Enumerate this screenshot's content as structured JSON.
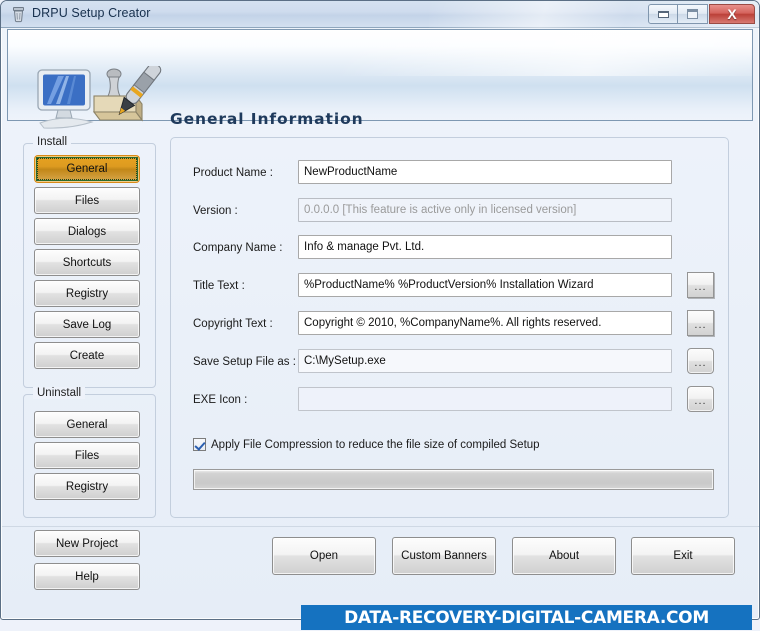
{
  "window": {
    "title": "DRPU Setup Creator",
    "icon": "app-icon",
    "controls": {
      "minimize": "minimize-icon",
      "maximize": "maximize-icon",
      "close": "X"
    }
  },
  "banner": {
    "heading": "General Information",
    "art": "computer-stamp-pen-illustration"
  },
  "sidebar": {
    "install": {
      "legend": "Install",
      "items": [
        {
          "label": "General",
          "selected": true
        },
        {
          "label": "Files",
          "selected": false
        },
        {
          "label": "Dialogs",
          "selected": false
        },
        {
          "label": "Shortcuts",
          "selected": false
        },
        {
          "label": "Registry",
          "selected": false
        },
        {
          "label": "Save Log",
          "selected": false
        },
        {
          "label": "Create",
          "selected": false
        }
      ]
    },
    "uninstall": {
      "legend": "Uninstall",
      "items": [
        {
          "label": "General"
        },
        {
          "label": "Files"
        },
        {
          "label": "Registry"
        }
      ]
    },
    "extra": [
      {
        "label": "New Project"
      },
      {
        "label": "Help"
      }
    ]
  },
  "form": {
    "fields": [
      {
        "label": "Product Name :",
        "value": "NewProductName",
        "state": "normal",
        "browse": false
      },
      {
        "label": "Version :",
        "value": "0.0.0.0 [This feature is active only in licensed version]",
        "state": "disabled",
        "browse": false
      },
      {
        "label": "Company Name :",
        "value": "Info & manage Pvt. Ltd.",
        "state": "normal",
        "browse": false
      },
      {
        "label": "Title Text :",
        "value": "%ProductName% %ProductVersion% Installation Wizard",
        "state": "normal",
        "browse": true,
        "browse_style": "flat"
      },
      {
        "label": "Copyright Text :",
        "value": "Copyright © 2010, %CompanyName%. All rights reserved.",
        "state": "normal",
        "browse": true,
        "browse_style": "flat"
      },
      {
        "label": "Save Setup File as :",
        "value": "C:\\MySetup.exe",
        "state": "normal",
        "browse": true,
        "browse_style": "round"
      },
      {
        "label": "EXE Icon :",
        "value": "",
        "state": "empty",
        "browse": true,
        "browse_style": "round"
      }
    ],
    "browse_label": "...",
    "checkbox": {
      "label": "Apply File Compression to reduce the file size of compiled Setup",
      "checked": true
    },
    "progress": {
      "value": 0
    }
  },
  "actions": [
    {
      "label": "Open"
    },
    {
      "label": "Custom Banners"
    },
    {
      "label": "About"
    },
    {
      "label": "Exit"
    }
  ],
  "watermark": {
    "text": "DATA-RECOVERY-DIGITAL-CAMERA.COM",
    "background": "#1572c0",
    "color": "#ffffff"
  },
  "colors": {
    "accent_selected": "#dd9b20",
    "window_bg": "#eef2fa",
    "title_text": "#17304d",
    "heading": "#1f3a5c",
    "close_button": "#bb4038"
  }
}
